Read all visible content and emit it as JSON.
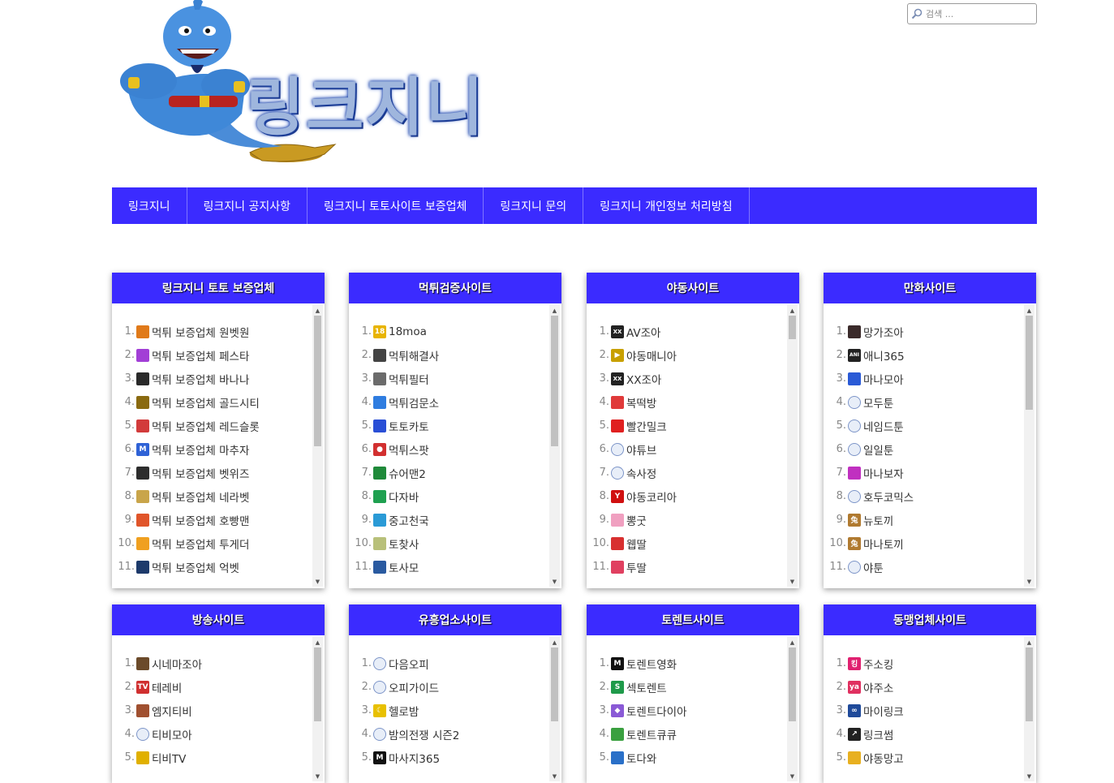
{
  "site": {
    "logo_text": "링크지니",
    "search_placeholder": "검색 ..."
  },
  "nav": [
    "링크지니",
    "링크지니 공지사항",
    "링크지니 토토사이트 보증업체",
    "링크지니 문의",
    "링크지니 개인정보 처리방침"
  ],
  "panels": [
    {
      "title": "링크지니 토토 보증업체",
      "scroll_position": 0.0,
      "items": [
        {
          "n": "1.",
          "label": "먹튀 보증업체 원벳원",
          "icon": "wonbet-icon",
          "color": "#e07a1a"
        },
        {
          "n": "2.",
          "label": "먹튀 보증업체 페스타",
          "icon": "festa-icon",
          "color": "#a23fd6"
        },
        {
          "n": "3.",
          "label": "먹튀 보증업체 바나나",
          "icon": "banana-icon",
          "color": "#2a2a2a"
        },
        {
          "n": "4.",
          "label": "먹튀 보증업체 골드시티",
          "icon": "goldcity-icon",
          "color": "#8a6a10"
        },
        {
          "n": "5.",
          "label": "먹튀 보증업체 레드슬롯",
          "icon": "redslot-icon",
          "color": "#d23b3b"
        },
        {
          "n": "6.",
          "label": "먹튀 보증업체 마추자",
          "icon": "m-icon",
          "color": "#2f62d6"
        },
        {
          "n": "7.",
          "label": "먹튀 보증업체 벳위즈",
          "icon": "betwiz-icon",
          "color": "#2d2d2d"
        },
        {
          "n": "8.",
          "label": "먹튀 보증업체 네라벳",
          "icon": "nerabet-icon",
          "color": "#c9a54a"
        },
        {
          "n": "9.",
          "label": "먹튀 보증업체 호빵맨",
          "icon": "hobbang-icon",
          "color": "#e0552a"
        },
        {
          "n": "10.",
          "label": "먹튀 보증업체 투게더",
          "icon": "together-icon",
          "color": "#f0a020"
        },
        {
          "n": "11.",
          "label": "먹튀 보증업체 억벳",
          "icon": "eokbet-icon",
          "color": "#1d3a6b"
        }
      ]
    },
    {
      "title": "먹튀검증사이트",
      "scroll_position": 0.0,
      "items": [
        {
          "n": "1.",
          "label": "18moa",
          "icon": "18moa-icon",
          "color": "#e8b400"
        },
        {
          "n": "2.",
          "label": "먹튀해결사",
          "icon": "solver-icon",
          "color": "#444444"
        },
        {
          "n": "3.",
          "label": "먹튀필터",
          "icon": "filter-icon",
          "color": "#6b6b6b"
        },
        {
          "n": "4.",
          "label": "먹튀검문소",
          "icon": "checkpoint-icon",
          "color": "#2f7de0"
        },
        {
          "n": "5.",
          "label": "토토카토",
          "icon": "totocato-icon",
          "color": "#2a4fd6"
        },
        {
          "n": "6.",
          "label": "먹튀스팟",
          "icon": "map-pin-icon",
          "color": "#d23030"
        },
        {
          "n": "7.",
          "label": "슈어맨2",
          "icon": "sureman-icon",
          "color": "#1f8a3a"
        },
        {
          "n": "8.",
          "label": "다자바",
          "icon": "dazaba-icon",
          "color": "#1fa050"
        },
        {
          "n": "9.",
          "label": "중고천국",
          "icon": "used-heaven-icon",
          "color": "#2a9ad6"
        },
        {
          "n": "10.",
          "label": "토찾사",
          "icon": "tochatsa-icon",
          "color": "#b8c07a"
        },
        {
          "n": "11.",
          "label": "토사모",
          "icon": "tosamo-icon",
          "color": "#2a5aa0"
        }
      ]
    },
    {
      "title": "야동사이트",
      "scroll_position": 0.0,
      "items": [
        {
          "n": "1.",
          "label": "AV조아",
          "icon": "xx-icon",
          "color": "#222222"
        },
        {
          "n": "2.",
          "label": "야동매니아",
          "icon": "play-icon",
          "color": "#c8a000"
        },
        {
          "n": "3.",
          "label": "XX조아",
          "icon": "xx-icon",
          "color": "#222222"
        },
        {
          "n": "4.",
          "label": "복떡방",
          "icon": "bokddeok-icon",
          "color": "#e03a3a"
        },
        {
          "n": "5.",
          "label": "빨간밀크",
          "icon": "redmilk-icon",
          "color": "#e02020"
        },
        {
          "n": "6.",
          "label": "야튜브",
          "icon": "globe-icon",
          "color": "#7d95c8"
        },
        {
          "n": "7.",
          "label": "속사정",
          "icon": "globe-icon",
          "color": "#7d95c8"
        },
        {
          "n": "8.",
          "label": "야동코리아",
          "icon": "y-icon",
          "color": "#d01010"
        },
        {
          "n": "9.",
          "label": "뽕굿",
          "icon": "ppong-icon",
          "color": "#f0a0c0"
        },
        {
          "n": "10.",
          "label": "웹딸",
          "icon": "webddal-icon",
          "color": "#d83030"
        },
        {
          "n": "11.",
          "label": "투딸",
          "icon": "tooddal-icon",
          "color": "#e04060"
        }
      ]
    },
    {
      "title": "만화사이트",
      "scroll_position": 0.0,
      "items": [
        {
          "n": "1.",
          "label": "망가조아",
          "icon": "manga-icon",
          "color": "#3a2a2a"
        },
        {
          "n": "2.",
          "label": "애니365",
          "icon": "ani-icon",
          "color": "#222222"
        },
        {
          "n": "3.",
          "label": "마나모아",
          "icon": "manamoa-icon",
          "color": "#2a5ad6"
        },
        {
          "n": "4.",
          "label": "모두툰",
          "icon": "globe-icon",
          "color": "#7d95c8"
        },
        {
          "n": "5.",
          "label": "네임드툰",
          "icon": "globe-icon",
          "color": "#7d95c8"
        },
        {
          "n": "6.",
          "label": "일일툰",
          "icon": "globe-icon",
          "color": "#7d95c8"
        },
        {
          "n": "7.",
          "label": "마나보자",
          "icon": "manaboza-icon",
          "color": "#c030c0"
        },
        {
          "n": "8.",
          "label": "호두코믹스",
          "icon": "globe-icon",
          "color": "#7d95c8"
        },
        {
          "n": "9.",
          "label": "뉴토끼",
          "icon": "rabbit-icon",
          "color": "#b07a30"
        },
        {
          "n": "10.",
          "label": "마나토끼",
          "icon": "rabbit-icon",
          "color": "#b07a30"
        },
        {
          "n": "11.",
          "label": "야툰",
          "icon": "globe-icon",
          "color": "#7d95c8"
        }
      ]
    },
    {
      "title": "방송사이트",
      "scroll_position": 0.0,
      "items": [
        {
          "n": "1.",
          "label": "시네마조아",
          "icon": "cinema-icon",
          "color": "#6b4a2a"
        },
        {
          "n": "2.",
          "label": "테레비",
          "icon": "tv-icon",
          "color": "#d03030"
        },
        {
          "n": "3.",
          "label": "엠지티비",
          "icon": "mgtv-icon",
          "color": "#a05030"
        },
        {
          "n": "4.",
          "label": "티비모아",
          "icon": "globe-icon",
          "color": "#7d95c8"
        },
        {
          "n": "5.",
          "label": "티비TV",
          "icon": "tvtv-icon",
          "color": "#e0b000"
        }
      ]
    },
    {
      "title": "유흥업소사이트",
      "scroll_position": 0.0,
      "items": [
        {
          "n": "1.",
          "label": "다음오피",
          "icon": "globe-icon",
          "color": "#7d95c8"
        },
        {
          "n": "2.",
          "label": "오피가이드",
          "icon": "globe-icon",
          "color": "#7d95c8"
        },
        {
          "n": "3.",
          "label": "헬로밤",
          "icon": "moon-icon",
          "color": "#e8c000"
        },
        {
          "n": "4.",
          "label": "밤의전쟁 시즌2",
          "icon": "globe-icon",
          "color": "#7d95c8"
        },
        {
          "n": "5.",
          "label": "마사지365",
          "icon": "m-black-icon",
          "color": "#111111"
        }
      ]
    },
    {
      "title": "토렌트사이트",
      "scroll_position": 0.0,
      "items": [
        {
          "n": "1.",
          "label": "토렌트영화",
          "icon": "m-black-icon",
          "color": "#111111"
        },
        {
          "n": "2.",
          "label": "섹토렌트",
          "icon": "s-icon",
          "color": "#1f9a4a"
        },
        {
          "n": "3.",
          "label": "토렌트다이아",
          "icon": "diamond-icon",
          "color": "#8a5ad6"
        },
        {
          "n": "4.",
          "label": "토렌트큐큐",
          "icon": "torrentqq-icon",
          "color": "#3aa040"
        },
        {
          "n": "5.",
          "label": "토다와",
          "icon": "todawa-icon",
          "color": "#2a70c8"
        }
      ]
    },
    {
      "title": "동맹업체사이트",
      "scroll_position": 0.0,
      "items": [
        {
          "n": "1.",
          "label": "주소킹",
          "icon": "king-icon",
          "color": "#e02070"
        },
        {
          "n": "2.",
          "label": "야주소",
          "icon": "ya-icon",
          "color": "#e03060"
        },
        {
          "n": "3.",
          "label": "마이링크",
          "icon": "link-icon",
          "color": "#1f4a9a"
        },
        {
          "n": "4.",
          "label": "링크썸",
          "icon": "external-link-icon",
          "color": "#222222"
        },
        {
          "n": "5.",
          "label": "야동망고",
          "icon": "mango-icon",
          "color": "#e8b020"
        }
      ]
    }
  ]
}
